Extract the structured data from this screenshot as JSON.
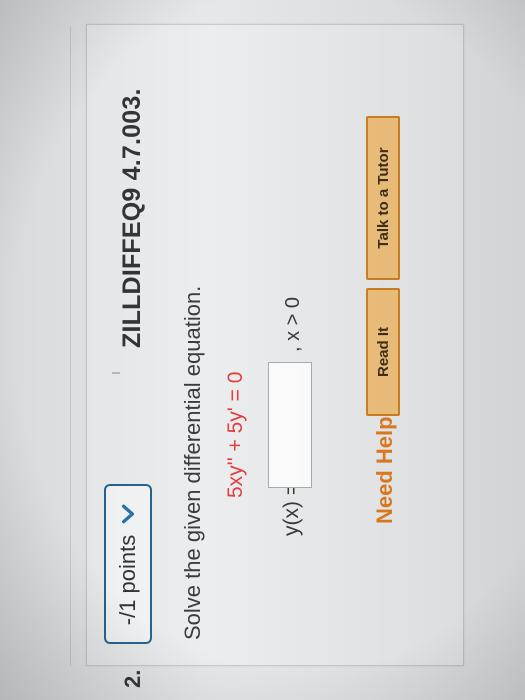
{
  "question": {
    "number": "2.",
    "points_label": "-/1 points",
    "id": "ZILLDIFFEQ9 4.7.003.",
    "prompt": "Solve the given differential equation.",
    "equation": {
      "part1": "5xy'' + 5y' = 0"
    },
    "answer_label": "y(x) =",
    "answer_value": "",
    "condition": ", x > 0"
  },
  "help": {
    "label": "Need Help?",
    "read_it": "Read It",
    "talk_to_tutor": "Talk to a Tutor"
  },
  "colors": {
    "points_border": "#1f5f8a",
    "equation_red": "#e03434",
    "need_help_orange": "#e07a1a",
    "button_fill": "#f2c17a"
  }
}
